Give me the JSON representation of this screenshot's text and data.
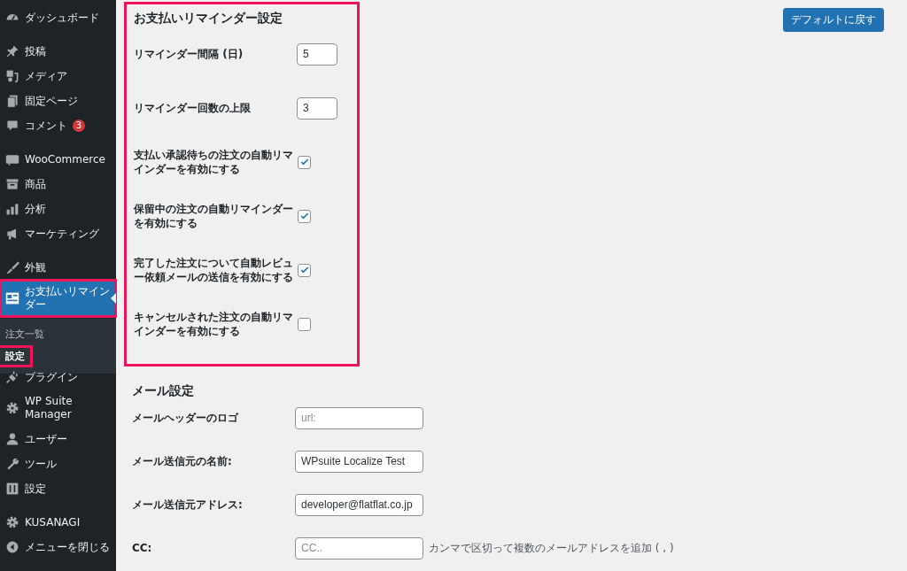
{
  "sidebar": {
    "groups": [
      {
        "items": [
          {
            "label": "ダッシュボード",
            "selected": false
          }
        ]
      },
      {
        "items": [
          {
            "label": "投稿",
            "selected": false
          },
          {
            "label": "メディア",
            "selected": false
          },
          {
            "label": "固定ページ",
            "selected": false
          },
          {
            "label": "コメント",
            "selected": false,
            "badge": "3"
          }
        ]
      },
      {
        "items": [
          {
            "label": "WooCommerce",
            "selected": false
          },
          {
            "label": "商品",
            "selected": false
          },
          {
            "label": "分析",
            "selected": false
          },
          {
            "label": "マーケティング",
            "selected": false
          }
        ]
      },
      {
        "items": [
          {
            "label": "外観",
            "selected": false
          },
          {
            "label": "お支払いリマインダー",
            "selected": true,
            "highlighted": true,
            "children": [
              {
                "label": "注文一覧",
                "selected": false,
                "highlighted": false
              },
              {
                "label": "設定",
                "selected": true,
                "highlighted": true
              }
            ]
          },
          {
            "label": "プラグイン",
            "selected": false
          },
          {
            "label": "WP Suite Manager",
            "selected": false
          },
          {
            "label": "ユーザー",
            "selected": false
          },
          {
            "label": "ツール",
            "selected": false
          },
          {
            "label": "設定",
            "selected": false
          }
        ]
      },
      {
        "items": [
          {
            "label": "KUSANAGI",
            "selected": false
          },
          {
            "label": "メニューを閉じる",
            "selected": false
          }
        ]
      }
    ]
  },
  "reset_button": "デフォルトに戻す",
  "sections": [
    {
      "title": "お支払いリマインダー設定",
      "highlighted": true,
      "rows": [
        {
          "kind": "number",
          "label": "リマインダー間隔 (日)",
          "value": "5"
        },
        {
          "kind": "number",
          "label": "リマインダー回数の上限",
          "value": "3"
        },
        {
          "kind": "checkbox",
          "label": "支払い承認待ちの注文の自動リマインダーを有効にする",
          "checked": true
        },
        {
          "kind": "checkbox",
          "label": "保留中の注文の自動リマインダーを有効にする",
          "checked": true
        },
        {
          "kind": "checkbox",
          "label": "完了した注文について自動レビュー依頼メールの送信を有効にする",
          "checked": true
        },
        {
          "kind": "checkbox",
          "label": "キャンセルされた注文の自動リマインダーを有効にする",
          "checked": false
        }
      ]
    },
    {
      "title": "メール設定",
      "highlighted": false,
      "rows": [
        {
          "kind": "text",
          "label": "メールヘッダーのロゴ",
          "placeholder": "url:"
        },
        {
          "kind": "text",
          "label": "メール送信元の名前:",
          "value": "WPsuite Localize Test"
        },
        {
          "kind": "text",
          "label": "メール送信元アドレス:",
          "value": "developer@flatflat.co.jp"
        },
        {
          "kind": "text",
          "label": "CC:",
          "placeholder": "CC..",
          "description": "カンマで区切って複数のメールアドレスを追加 ( , )"
        }
      ]
    }
  ]
}
